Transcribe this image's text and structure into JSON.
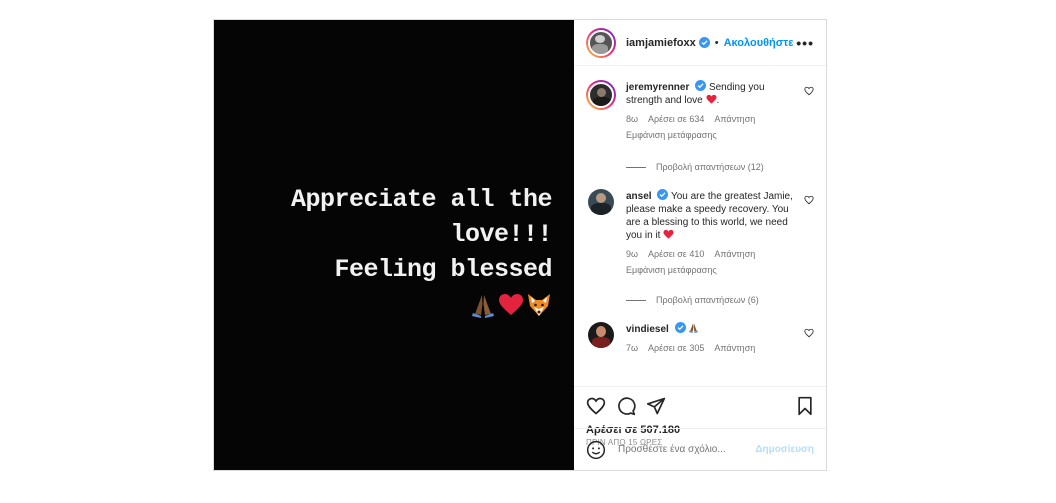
{
  "post": {
    "author": "iamjamiefoxx",
    "dot": "•",
    "follow_label": "Ακολουθήστε",
    "more_label": "•••",
    "story_lines": [
      "Appreciate all the",
      "love!!!",
      "Feeling blessed"
    ],
    "story_emojis": [
      "folded-hands",
      "red-heart",
      "fox-face"
    ]
  },
  "comments": [
    {
      "user": "jeremyrenner",
      "text": "Sending you strength and love",
      "emoji": "red-heart",
      "suffix": ".",
      "time": "8ω",
      "likes": "Αρέσει σε 634",
      "reply": "Απάντηση",
      "translate": "Εμφάνιση μετάφρασης",
      "view_replies": "Προβολή απαντήσεων (12)"
    },
    {
      "user": "ansel",
      "text": "You are the greatest Jamie, please make a speedy recovery. You are a blessing to this world, we need you in it",
      "emoji": "red-heart",
      "time": "9ω",
      "likes": "Αρέσει σε 410",
      "reply": "Απάντηση",
      "translate": "Εμφάνιση μετάφρασης",
      "view_replies": "Προβολή απαντήσεων (6)"
    },
    {
      "user": "vindiesel",
      "emoji": "folded-hands",
      "time": "7ω",
      "likes": "Αρέσει σε 305",
      "reply": "Απάντηση"
    }
  ],
  "footer": {
    "likes": "Αρέσει σε 507.180",
    "time": "ΠΡΙΝ ΑΠΟ 15 ΩΡΕΣ",
    "comment_placeholder": "Προσθέστε ένα σχόλιο...",
    "post_label": "Δημοσίευση"
  },
  "colors": {
    "accent": "#0095f6",
    "verified": "#3897f0",
    "heart": "#e0245e",
    "post_disabled": "#b2dffc"
  }
}
